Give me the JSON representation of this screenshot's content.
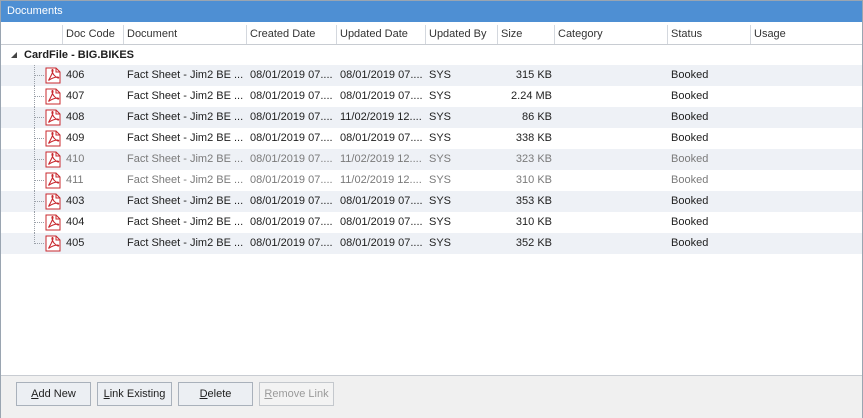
{
  "window": {
    "title": "Documents"
  },
  "columns": [
    "",
    "Doc Code",
    "Document",
    "Created Date",
    "Updated Date",
    "Updated By",
    "Size",
    "Category",
    "Status",
    "Usage"
  ],
  "group": {
    "label": "CardFile - BIG.BIKES"
  },
  "rows": [
    {
      "code": "406",
      "document": "Fact Sheet - Jim2 BE ...",
      "created": "08/01/2019 07....",
      "updated": "08/01/2019 07....",
      "by": "SYS",
      "size": "315 KB",
      "category": "",
      "status": "Booked",
      "usage": "",
      "dim": false
    },
    {
      "code": "407",
      "document": "Fact Sheet - Jim2 BE ...",
      "created": "08/01/2019 07....",
      "updated": "08/01/2019 07....",
      "by": "SYS",
      "size": "2.24 MB",
      "category": "",
      "status": "Booked",
      "usage": "",
      "dim": false
    },
    {
      "code": "408",
      "document": "Fact Sheet - Jim2 BE ...",
      "created": "08/01/2019 07....",
      "updated": "11/02/2019 12....",
      "by": "SYS",
      "size": "86 KB",
      "category": "",
      "status": "Booked",
      "usage": "",
      "dim": false
    },
    {
      "code": "409",
      "document": "Fact Sheet - Jim2 BE ...",
      "created": "08/01/2019 07....",
      "updated": "08/01/2019 07....",
      "by": "SYS",
      "size": "338 KB",
      "category": "",
      "status": "Booked",
      "usage": "",
      "dim": false
    },
    {
      "code": "410",
      "document": "Fact Sheet - Jim2 BE ...",
      "created": "08/01/2019 07....",
      "updated": "11/02/2019 12....",
      "by": "SYS",
      "size": "323 KB",
      "category": "",
      "status": "Booked",
      "usage": "",
      "dim": true
    },
    {
      "code": "411",
      "document": "Fact Sheet - Jim2 BE ...",
      "created": "08/01/2019 07....",
      "updated": "11/02/2019 12....",
      "by": "SYS",
      "size": "310 KB",
      "category": "",
      "status": "Booked",
      "usage": "",
      "dim": true
    },
    {
      "code": "403",
      "document": "Fact Sheet - Jim2 BE ...",
      "created": "08/01/2019 07....",
      "updated": "08/01/2019 07....",
      "by": "SYS",
      "size": "353 KB",
      "category": "",
      "status": "Booked",
      "usage": "",
      "dim": false
    },
    {
      "code": "404",
      "document": "Fact Sheet - Jim2 BE ...",
      "created": "08/01/2019 07....",
      "updated": "08/01/2019 07....",
      "by": "SYS",
      "size": "310 KB",
      "category": "",
      "status": "Booked",
      "usage": "",
      "dim": false
    },
    {
      "code": "405",
      "document": "Fact Sheet - Jim2 BE ...",
      "created": "08/01/2019 07....",
      "updated": "08/01/2019 07....",
      "by": "SYS",
      "size": "352 KB",
      "category": "",
      "status": "Booked",
      "usage": "",
      "dim": false
    }
  ],
  "buttons": {
    "add_new": {
      "label": "Add New",
      "enabled": true
    },
    "link_existing": {
      "label": "Link Existing",
      "enabled": true
    },
    "delete": {
      "label": "Delete",
      "enabled": true
    },
    "remove_link": {
      "label": "Remove Link",
      "enabled": false
    }
  },
  "icons": {
    "file": "pdf-file-icon",
    "group_toggle": "collapse-triangle-icon"
  },
  "colors": {
    "titlebar": "#4e8fd3",
    "alt_row": "#eef1f6",
    "pdf_red": "#c8282e"
  }
}
